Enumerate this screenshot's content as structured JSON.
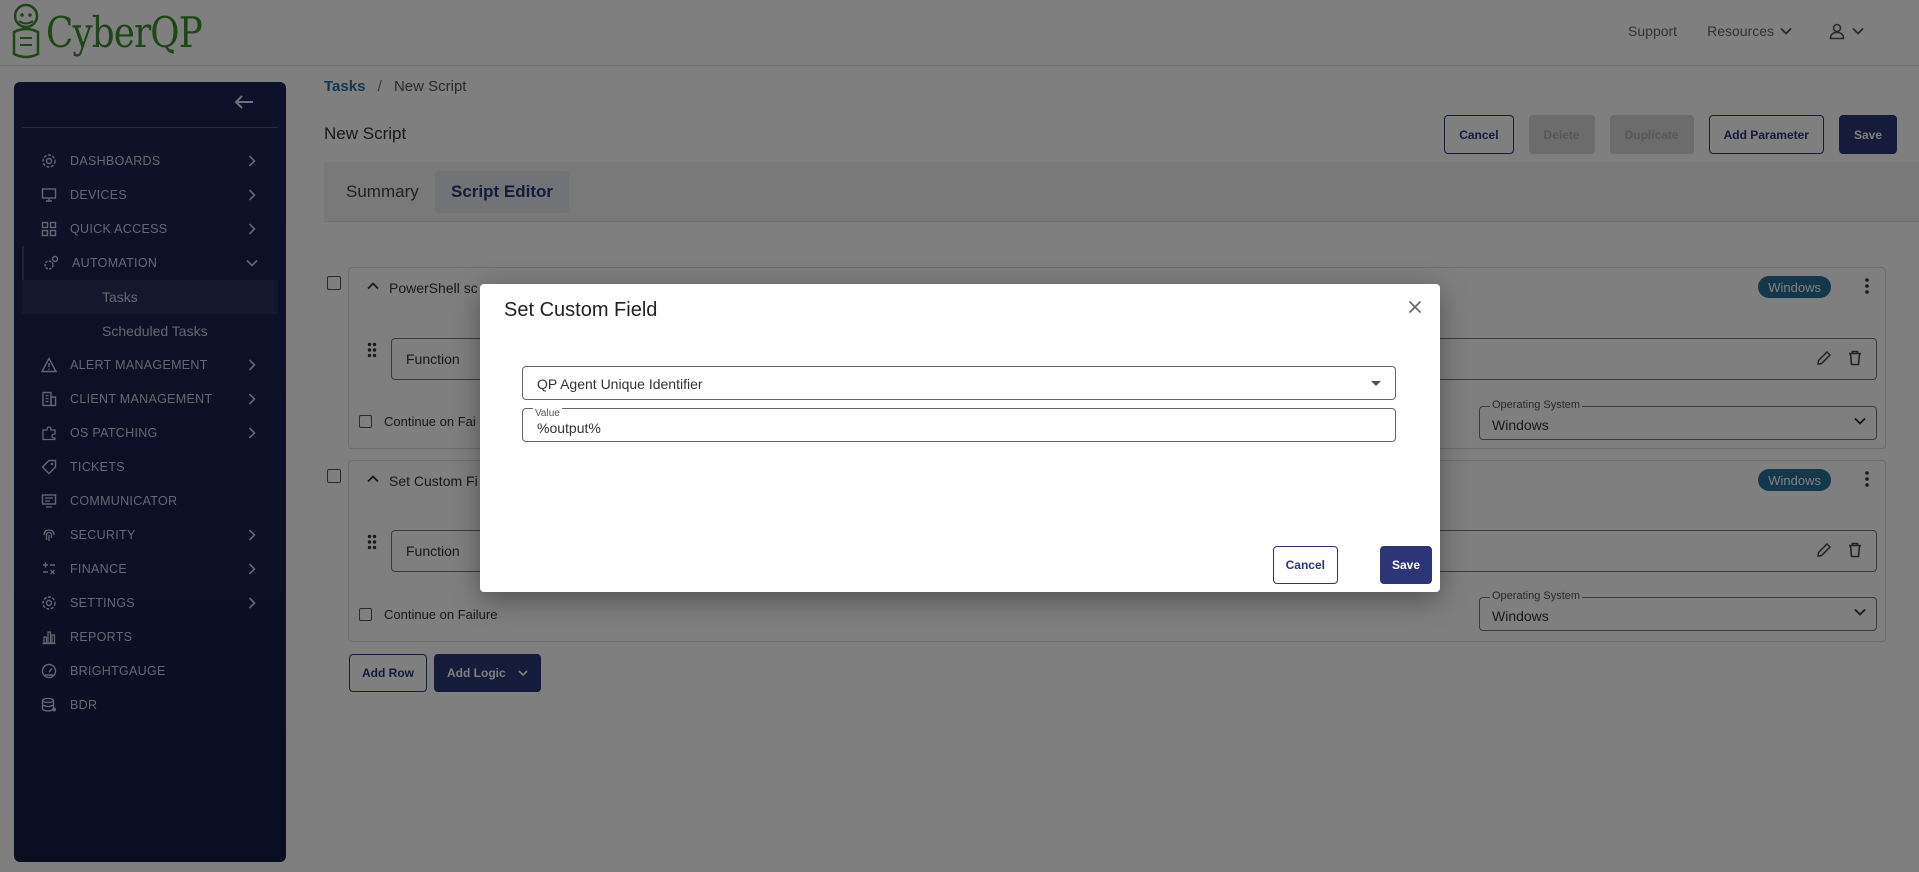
{
  "brand": {
    "logo_text": "CyberQP"
  },
  "top_nav": {
    "support": "Support",
    "resources": "Resources"
  },
  "sidebar": {
    "items": [
      {
        "label": "DASHBOARDS"
      },
      {
        "label": "DEVICES"
      },
      {
        "label": "QUICK ACCESS"
      },
      {
        "label": "AUTOMATION"
      },
      {
        "label": "ALERT MANAGEMENT"
      },
      {
        "label": "CLIENT MANAGEMENT"
      },
      {
        "label": "OS PATCHING"
      },
      {
        "label": "TICKETS"
      },
      {
        "label": "COMMUNICATOR"
      },
      {
        "label": "SECURITY"
      },
      {
        "label": "FINANCE"
      },
      {
        "label": "SETTINGS"
      },
      {
        "label": "REPORTS"
      },
      {
        "label": "BRIGHTGAUGE"
      },
      {
        "label": "BDR"
      }
    ],
    "automation_sub": [
      {
        "label": "Tasks"
      },
      {
        "label": "Scheduled Tasks"
      }
    ]
  },
  "breadcrumb": {
    "root": "Tasks",
    "separator": "/",
    "current": "New Script"
  },
  "page_title": "New Script",
  "toolbar": {
    "cancel": "Cancel",
    "delete": "Delete",
    "duplicate": "Duplicate",
    "add_parameter": "Add Parameter",
    "save": "Save"
  },
  "tabs": [
    {
      "label": "Summary"
    },
    {
      "label": "Script Editor"
    }
  ],
  "steps": [
    {
      "title": "PowerShell sc",
      "badge": "Windows",
      "function_label": "Function",
      "continue_on_failure": "Continue on Fai",
      "os_label": "Operating System",
      "os_value": "Windows"
    },
    {
      "title": "Set Custom Fi",
      "badge": "Windows",
      "function_label": "Function",
      "continue_on_failure": "Continue on Failure",
      "os_label": "Operating System",
      "os_value": "Windows"
    }
  ],
  "actions": {
    "add_row": "Add Row",
    "add_logic": "Add Logic"
  },
  "modal": {
    "title": "Set Custom Field",
    "field_value": "QP Agent Unique Identifier",
    "value_label": "Value",
    "value": "%output%",
    "cancel": "Cancel",
    "save": "Save"
  },
  "colors": {
    "sidebar_bg": "#1b2554",
    "primary": "#2c3577",
    "badge": "#2b6e99",
    "link": "#2c6fa0",
    "logo": "#3d8c2f"
  }
}
